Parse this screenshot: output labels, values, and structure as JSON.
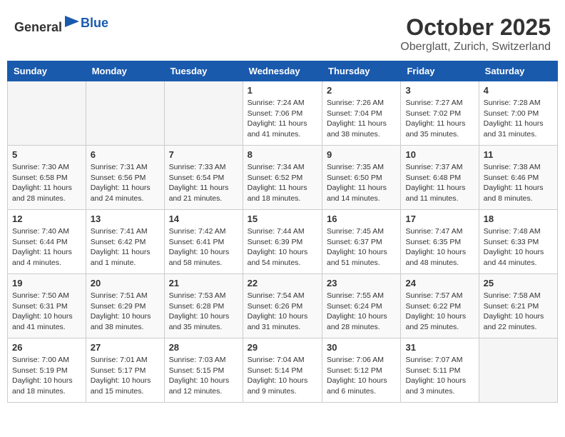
{
  "header": {
    "logo_general": "General",
    "logo_blue": "Blue",
    "month": "October 2025",
    "location": "Oberglatt, Zurich, Switzerland"
  },
  "days_of_week": [
    "Sunday",
    "Monday",
    "Tuesday",
    "Wednesday",
    "Thursday",
    "Friday",
    "Saturday"
  ],
  "weeks": [
    [
      {
        "day": "",
        "info": ""
      },
      {
        "day": "",
        "info": ""
      },
      {
        "day": "",
        "info": ""
      },
      {
        "day": "1",
        "info": "Sunrise: 7:24 AM\nSunset: 7:06 PM\nDaylight: 11 hours and 41 minutes."
      },
      {
        "day": "2",
        "info": "Sunrise: 7:26 AM\nSunset: 7:04 PM\nDaylight: 11 hours and 38 minutes."
      },
      {
        "day": "3",
        "info": "Sunrise: 7:27 AM\nSunset: 7:02 PM\nDaylight: 11 hours and 35 minutes."
      },
      {
        "day": "4",
        "info": "Sunrise: 7:28 AM\nSunset: 7:00 PM\nDaylight: 11 hours and 31 minutes."
      }
    ],
    [
      {
        "day": "5",
        "info": "Sunrise: 7:30 AM\nSunset: 6:58 PM\nDaylight: 11 hours and 28 minutes."
      },
      {
        "day": "6",
        "info": "Sunrise: 7:31 AM\nSunset: 6:56 PM\nDaylight: 11 hours and 24 minutes."
      },
      {
        "day": "7",
        "info": "Sunrise: 7:33 AM\nSunset: 6:54 PM\nDaylight: 11 hours and 21 minutes."
      },
      {
        "day": "8",
        "info": "Sunrise: 7:34 AM\nSunset: 6:52 PM\nDaylight: 11 hours and 18 minutes."
      },
      {
        "day": "9",
        "info": "Sunrise: 7:35 AM\nSunset: 6:50 PM\nDaylight: 11 hours and 14 minutes."
      },
      {
        "day": "10",
        "info": "Sunrise: 7:37 AM\nSunset: 6:48 PM\nDaylight: 11 hours and 11 minutes."
      },
      {
        "day": "11",
        "info": "Sunrise: 7:38 AM\nSunset: 6:46 PM\nDaylight: 11 hours and 8 minutes."
      }
    ],
    [
      {
        "day": "12",
        "info": "Sunrise: 7:40 AM\nSunset: 6:44 PM\nDaylight: 11 hours and 4 minutes."
      },
      {
        "day": "13",
        "info": "Sunrise: 7:41 AM\nSunset: 6:42 PM\nDaylight: 11 hours and 1 minute."
      },
      {
        "day": "14",
        "info": "Sunrise: 7:42 AM\nSunset: 6:41 PM\nDaylight: 10 hours and 58 minutes."
      },
      {
        "day": "15",
        "info": "Sunrise: 7:44 AM\nSunset: 6:39 PM\nDaylight: 10 hours and 54 minutes."
      },
      {
        "day": "16",
        "info": "Sunrise: 7:45 AM\nSunset: 6:37 PM\nDaylight: 10 hours and 51 minutes."
      },
      {
        "day": "17",
        "info": "Sunrise: 7:47 AM\nSunset: 6:35 PM\nDaylight: 10 hours and 48 minutes."
      },
      {
        "day": "18",
        "info": "Sunrise: 7:48 AM\nSunset: 6:33 PM\nDaylight: 10 hours and 44 minutes."
      }
    ],
    [
      {
        "day": "19",
        "info": "Sunrise: 7:50 AM\nSunset: 6:31 PM\nDaylight: 10 hours and 41 minutes."
      },
      {
        "day": "20",
        "info": "Sunrise: 7:51 AM\nSunset: 6:29 PM\nDaylight: 10 hours and 38 minutes."
      },
      {
        "day": "21",
        "info": "Sunrise: 7:53 AM\nSunset: 6:28 PM\nDaylight: 10 hours and 35 minutes."
      },
      {
        "day": "22",
        "info": "Sunrise: 7:54 AM\nSunset: 6:26 PM\nDaylight: 10 hours and 31 minutes."
      },
      {
        "day": "23",
        "info": "Sunrise: 7:55 AM\nSunset: 6:24 PM\nDaylight: 10 hours and 28 minutes."
      },
      {
        "day": "24",
        "info": "Sunrise: 7:57 AM\nSunset: 6:22 PM\nDaylight: 10 hours and 25 minutes."
      },
      {
        "day": "25",
        "info": "Sunrise: 7:58 AM\nSunset: 6:21 PM\nDaylight: 10 hours and 22 minutes."
      }
    ],
    [
      {
        "day": "26",
        "info": "Sunrise: 7:00 AM\nSunset: 5:19 PM\nDaylight: 10 hours and 18 minutes."
      },
      {
        "day": "27",
        "info": "Sunrise: 7:01 AM\nSunset: 5:17 PM\nDaylight: 10 hours and 15 minutes."
      },
      {
        "day": "28",
        "info": "Sunrise: 7:03 AM\nSunset: 5:15 PM\nDaylight: 10 hours and 12 minutes."
      },
      {
        "day": "29",
        "info": "Sunrise: 7:04 AM\nSunset: 5:14 PM\nDaylight: 10 hours and 9 minutes."
      },
      {
        "day": "30",
        "info": "Sunrise: 7:06 AM\nSunset: 5:12 PM\nDaylight: 10 hours and 6 minutes."
      },
      {
        "day": "31",
        "info": "Sunrise: 7:07 AM\nSunset: 5:11 PM\nDaylight: 10 hours and 3 minutes."
      },
      {
        "day": "",
        "info": ""
      }
    ]
  ]
}
